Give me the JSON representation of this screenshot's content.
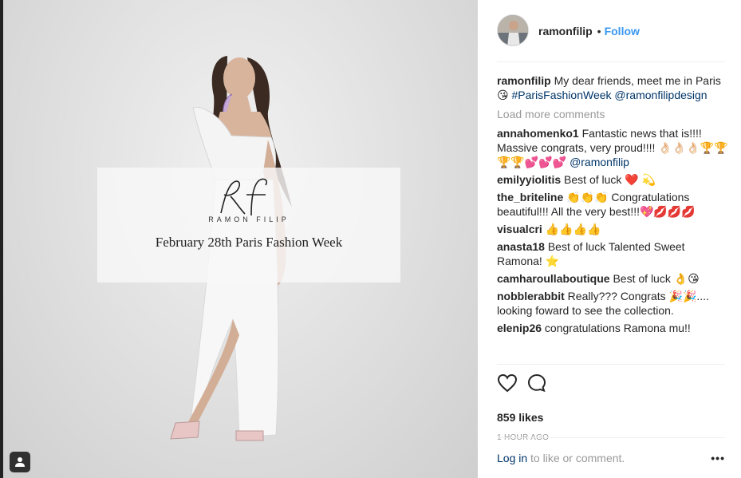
{
  "photo": {
    "overlay": {
      "wordmark": "RAMON FILIP",
      "event": "February 28th Paris Fashion Week"
    }
  },
  "post": {
    "username": "ramonfilip",
    "follow_label": "Follow",
    "caption": {
      "user": "ramonfilip",
      "text": "My dear friends, meet me in Paris 😘",
      "hashtag": "#ParisFashionWeek",
      "mention": "@ramonfilipdesign"
    },
    "load_more": "Load more comments",
    "comments": [
      {
        "user": "annahomenko1",
        "text": "Fantastic news that is!!!! Massive congrats, very proud!!!! 👌🏻👌🏻👌🏻🏆🏆🏆🏆💕💕💕",
        "mention": "@ramonfilip"
      },
      {
        "user": "emilyyiolitis",
        "text": "Best of luck ❤️ 💫"
      },
      {
        "user": "the_briteline",
        "text": "👏👏👏 Congratulations beautiful!!! All the very best!!!💖💋💋💋"
      },
      {
        "user": "visualcri",
        "text": "👍👍👍👍"
      },
      {
        "user": "anasta18",
        "text": "Best of luck Talented Sweet Ramona! ⭐"
      },
      {
        "user": "camharoullaboutique",
        "text": "Best of luck 👌😘"
      },
      {
        "user": "nobblerabbit",
        "text": "Really??? Congrats 🎉🎉.... looking foward to see the collection."
      },
      {
        "user": "elenip26",
        "text": "congratulations Ramona mu!!"
      }
    ],
    "likes": "859 likes",
    "time": "1 HOUR AGO",
    "footer": {
      "login": "Log in",
      "rest": "to like or comment.",
      "more": "•••"
    },
    "icons": {
      "like": "heart-icon",
      "comment": "comment-icon",
      "tag": "user-tag-icon"
    }
  }
}
